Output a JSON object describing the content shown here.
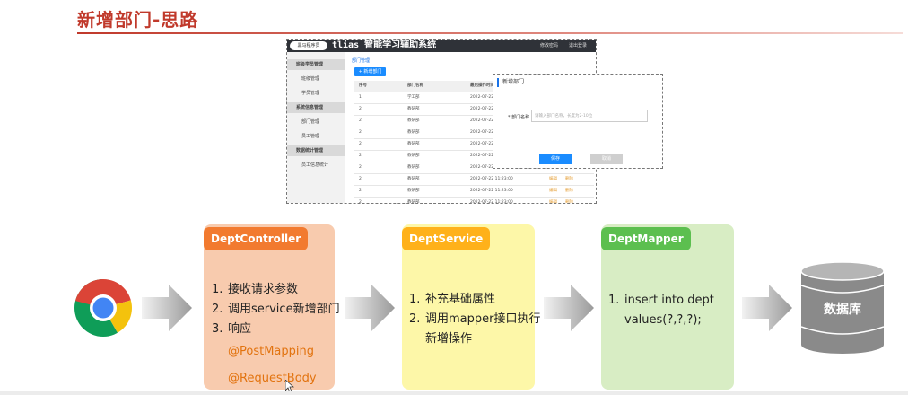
{
  "title": "新增部门-思路",
  "app": {
    "logo": "黑马程序员",
    "title": "tlias 智能学习辅助系统",
    "header_links": [
      "修改密码",
      "退出登录"
    ],
    "sidebar": [
      {
        "label": "班级学员管理",
        "group": true
      },
      {
        "label": "班级管理",
        "group": false
      },
      {
        "label": "学员管理",
        "group": false
      },
      {
        "label": "系统信息管理",
        "group": true
      },
      {
        "label": "部门管理",
        "group": false
      },
      {
        "label": "员工管理",
        "group": false
      },
      {
        "label": "数据统计管理",
        "group": true
      },
      {
        "label": "员工信息统计",
        "group": false
      }
    ],
    "breadcrumb": "部门管理",
    "add_button": "+ 新增部门",
    "table": {
      "headers": [
        "序号",
        "部门名称",
        "最后操作时间",
        "",
        ""
      ],
      "rows": [
        [
          "1",
          "学工部",
          "2022-07-22",
          "",
          ""
        ],
        [
          "2",
          "教研部",
          "2022-07-22",
          "",
          ""
        ],
        [
          "2",
          "教研部",
          "2022-07-22",
          "",
          ""
        ],
        [
          "2",
          "教研部",
          "2022-07-22",
          "",
          ""
        ],
        [
          "2",
          "教研部",
          "2022-07-22",
          "",
          ""
        ],
        [
          "2",
          "教研部",
          "2022-07-22",
          "",
          ""
        ],
        [
          "2",
          "教研部",
          "2022-07-22",
          "",
          ""
        ],
        [
          "2",
          "教研部",
          "2022-07-22 11:23:00",
          "编辑",
          "删除"
        ],
        [
          "2",
          "教研部",
          "2022-07-22 11:23:00",
          "编辑",
          "删除"
        ],
        [
          "2",
          "教研部",
          "2022-07-22 11:23:00",
          "编辑",
          "删除"
        ],
        [
          "2",
          "教研部",
          "2022-07-22 11:23:00",
          "编辑",
          "删除"
        ]
      ]
    }
  },
  "modal": {
    "title": "新增部门",
    "label": "* 部门名称",
    "placeholder": "请输入部门名称，长度为2-10位",
    "save": "保存",
    "cancel": "取消"
  },
  "flow": {
    "controller": {
      "tag": "DeptController",
      "items": [
        {
          "num": "1.",
          "text": "接收请求参数"
        },
        {
          "num": "2.",
          "text": "调用service新增部门"
        },
        {
          "num": "3.",
          "text": "响应"
        }
      ],
      "annotations": [
        "@PostMapping",
        "@RequestBody"
      ]
    },
    "service": {
      "tag": "DeptService",
      "items": [
        {
          "num": "1.",
          "text": "补充基础属性"
        },
        {
          "num": "2.",
          "text": "调用mapper接口执行"
        }
      ],
      "continuation": "新增操作"
    },
    "mapper": {
      "tag": "DeptMapper",
      "items": [
        {
          "num": "1.",
          "text": "insert into dept"
        }
      ],
      "continuation": "values(?,?,?);"
    },
    "database": "数据库"
  },
  "colors": {
    "title": "#c0392b",
    "controller_bg": "#f8cbae",
    "controller_tag": "#f27a2f",
    "service_bg": "#fdf7a8",
    "service_tag": "#ffb11a",
    "mapper_bg": "#d8edc4",
    "mapper_tag": "#5cbf4f",
    "annotation": "#e2730f"
  },
  "icons": [
    "chrome-browser-icon",
    "arrow-right-icon",
    "database-cylinder-icon",
    "mouse-cursor-icon"
  ]
}
